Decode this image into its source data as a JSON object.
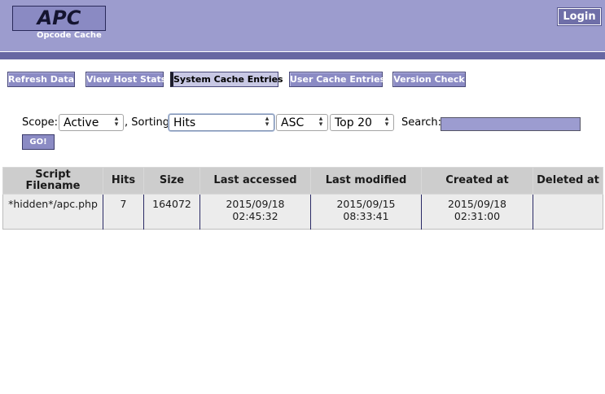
{
  "header": {
    "logo_title": "APC",
    "logo_subtitle": "Opcode Cache",
    "login_label": "Login"
  },
  "nav": {
    "items": [
      {
        "label": "Refresh Data"
      },
      {
        "label": "View Host Stats"
      },
      {
        "label": "System Cache Entries",
        "active": true
      },
      {
        "label": "User Cache Entries"
      },
      {
        "label": "Version Check"
      }
    ]
  },
  "filter": {
    "scope_label": "Scope:",
    "scope_value": "Active",
    "sorting_label": ", Sorting:",
    "sort_field": "Hits",
    "sort_order": "ASC",
    "limit": "Top 20",
    "search_label": "Search:",
    "search_value": "",
    "go_label": "GO!"
  },
  "table": {
    "headers": [
      "Script Filename",
      "Hits",
      "Size",
      "Last accessed",
      "Last modified",
      "Created at",
      "Deleted at"
    ],
    "rows": [
      [
        "*hidden*/apc.php",
        "7",
        "164072",
        "2015/09/18 02:45:32",
        "2015/09/15 08:33:41",
        "2015/09/18 02:31:00",
        ""
      ]
    ]
  },
  "colors": {
    "header_bg": "#9c9cce",
    "header_bar": "#6767a2",
    "nav_button": "#8b8bc4",
    "nav_active": "#c8c8e4"
  }
}
